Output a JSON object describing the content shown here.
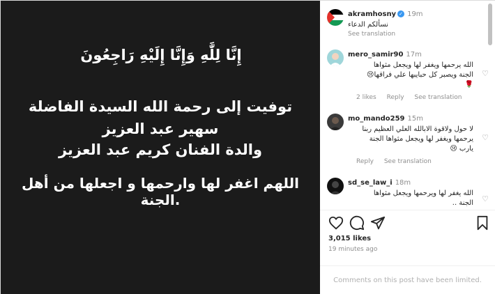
{
  "post_image": {
    "quran_line": "إِنَّا لِلَّٰهِ وَإِنَّا إِلَيْهِ رَاجِعُونَ",
    "line1": "توفيت إلى رحمة الله السيدة الفاضلة",
    "line2": "سهير عبد العزيز",
    "line3": "والدة الفنان كريم عبد العزيز",
    "dua": "اللهم اغفر لها وارحمها و اجعلها من أهل الجنة."
  },
  "caption": {
    "username": "akramhosny",
    "time": "19m",
    "text": "نسألكم الدعاء",
    "see_translation": "See translation"
  },
  "comments": [
    {
      "username": "mero_samir90",
      "time": "17m",
      "lines": [
        "الله يرحمها ويغفر لها ويجعل مثواها",
        "الجنة ويصبر كل حبايبها علي فراقها😢",
        "🌹"
      ],
      "likes": "2 likes",
      "reply": "Reply",
      "see_translation": "See translation"
    },
    {
      "username": "mo_mando259",
      "time": "15m",
      "lines": [
        "لا حول ولاقوة الابالله العلي العظيم ربنا",
        "يرحمها ويغفر لها ويجعل مثواها الجنة",
        "يارب 😢"
      ],
      "reply": "Reply",
      "see_translation": "See translation"
    },
    {
      "username": "sd_se_law_i",
      "time": "18m",
      "lines": [
        "الله يغفر لها ويرحمها ويجعل مثواها",
        "الجنة .."
      ]
    }
  ],
  "likes_count": "3,015 likes",
  "posted_ago": "19 minutes ago",
  "comments_limited": "Comments on this post have been limited.",
  "colors": {
    "image_bg": "#1b1b1b",
    "verified": "#3897f0",
    "muted": "#8e8e8e"
  }
}
